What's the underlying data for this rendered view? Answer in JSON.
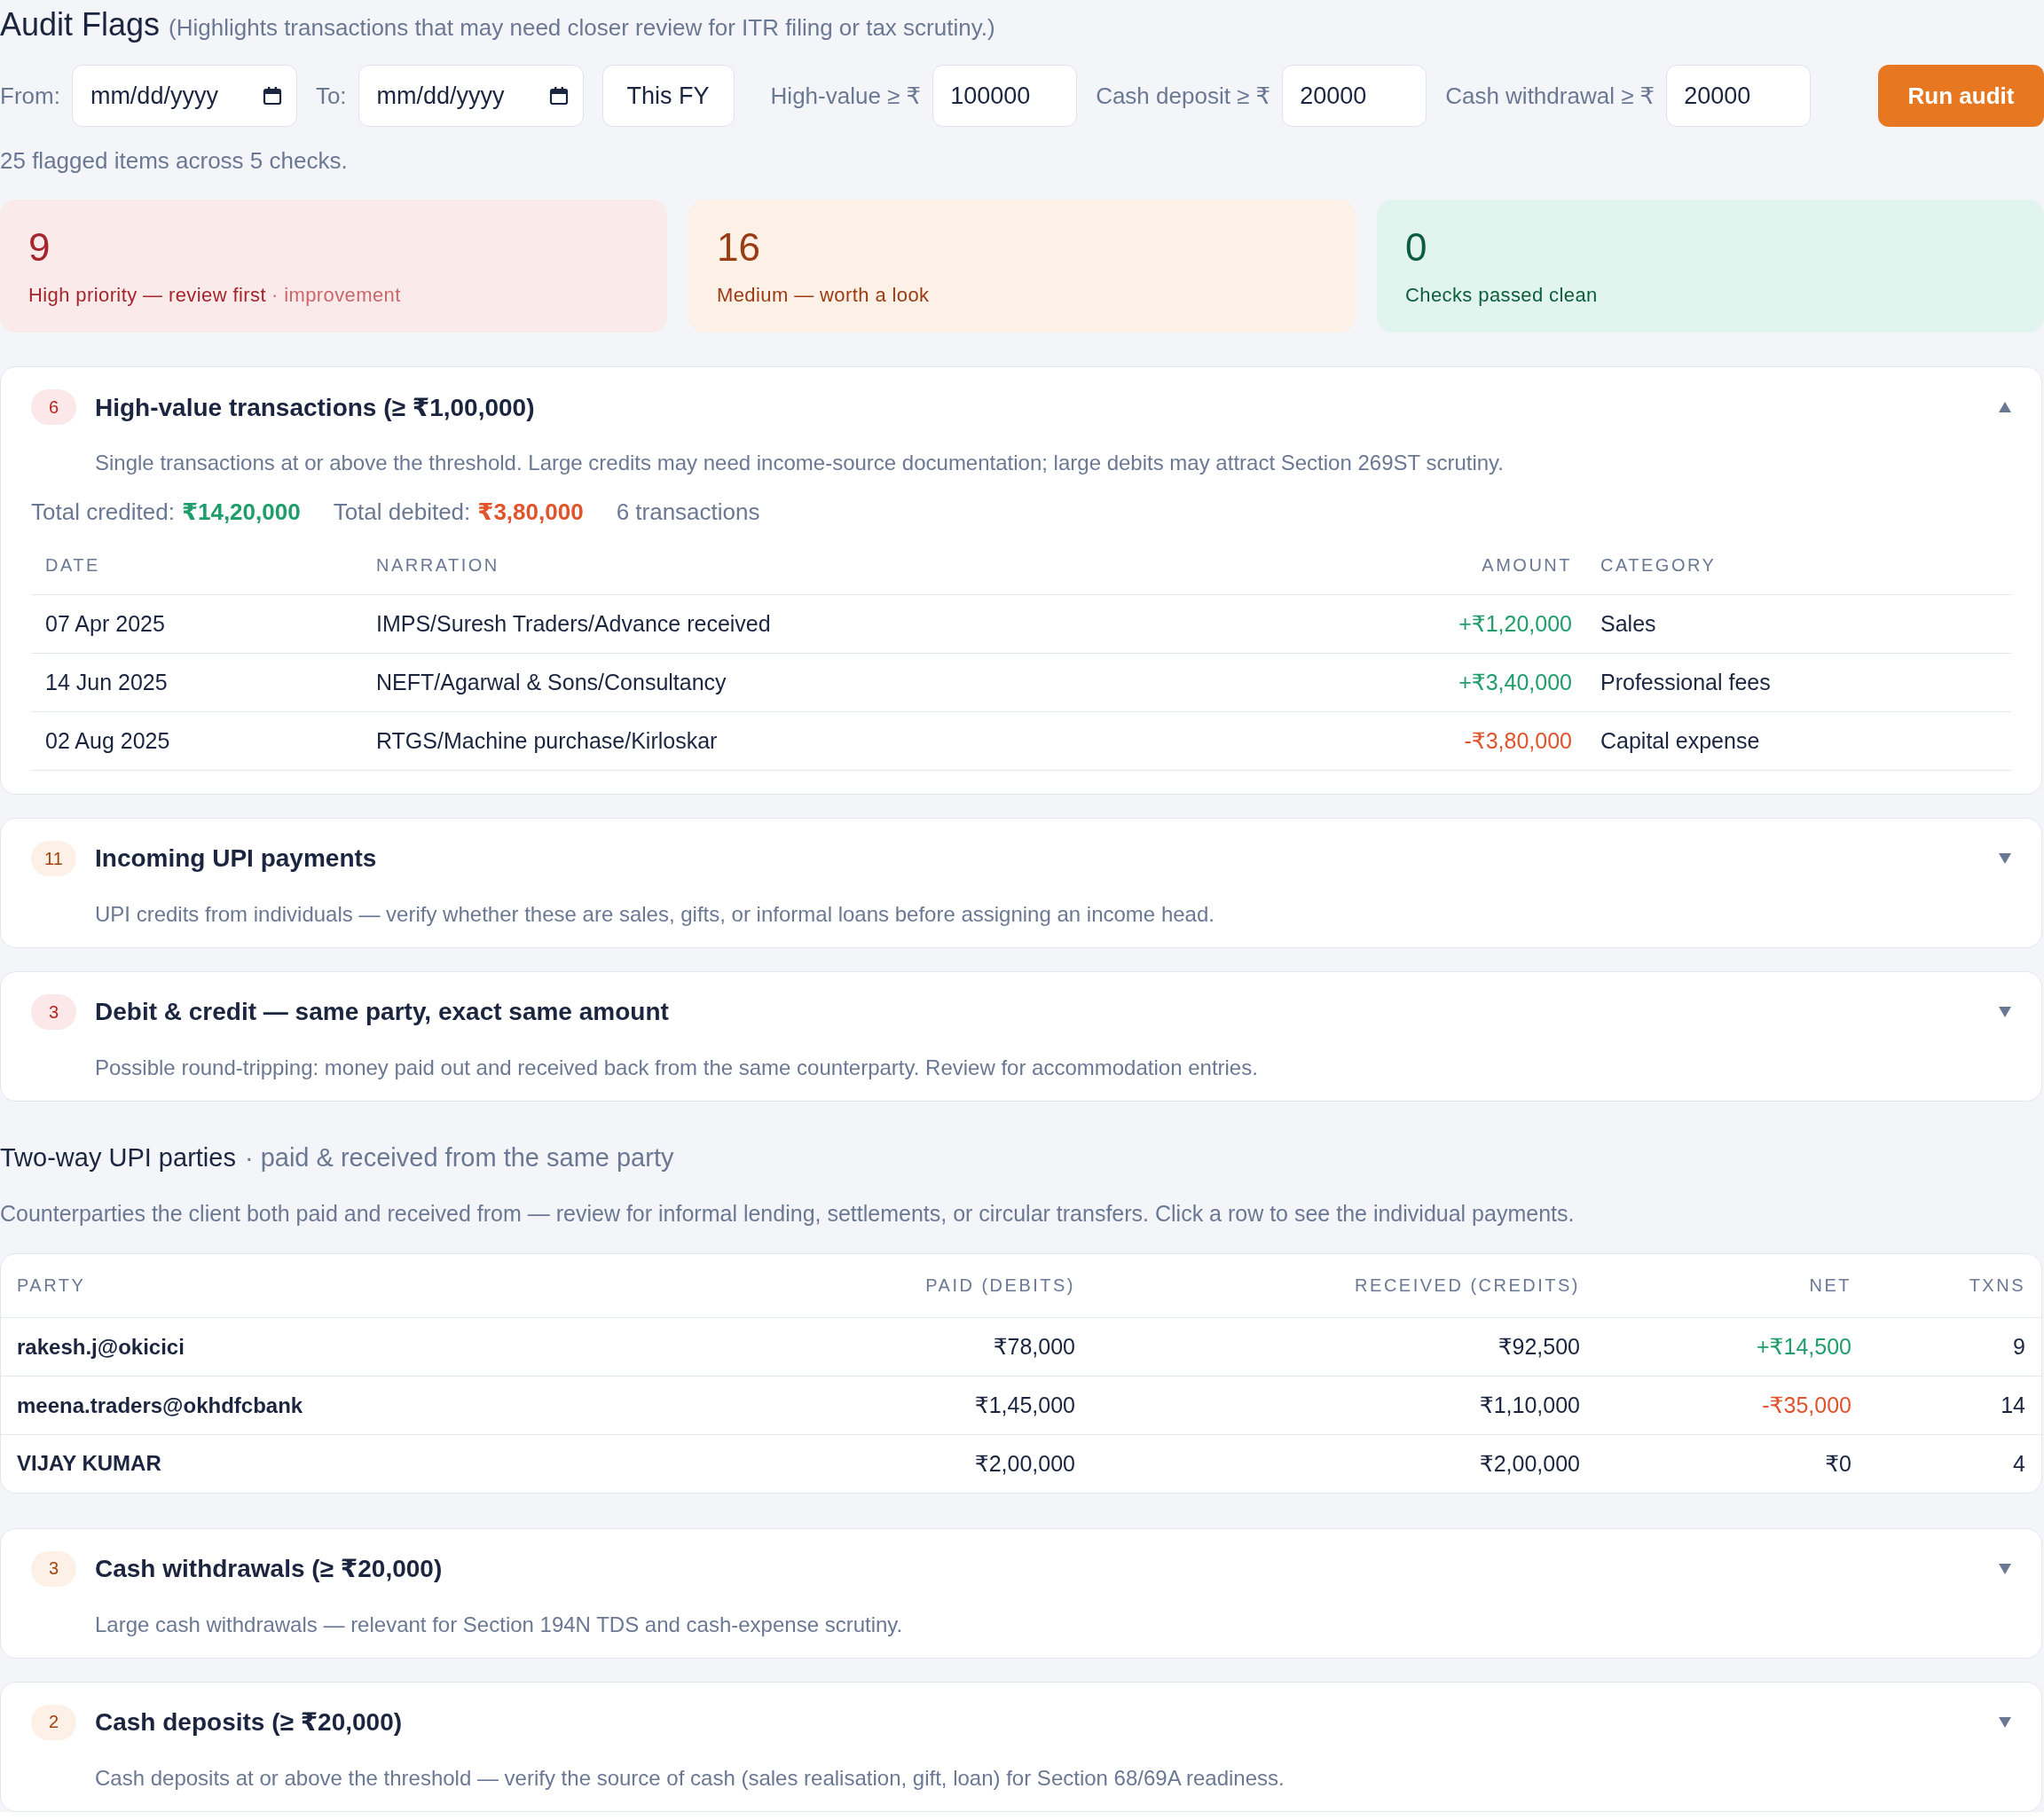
{
  "header": {
    "title": "Audit Flags",
    "subtitle": "(Highlights transactions that may need closer review for ITR filing or tax scrutiny.)"
  },
  "filters": {
    "from": {
      "label": "From:",
      "placeholder": "mm/dd/yyyy"
    },
    "to": {
      "label": "To:",
      "placeholder": "mm/dd/yyyy"
    },
    "preset_button": "This FY",
    "thresholds": [
      {
        "label": "High-value ≥ ₹",
        "value": "100000"
      },
      {
        "label": "Cash deposit ≥ ₹",
        "value": "20000"
      },
      {
        "label": "Cash withdrawal ≥ ₹",
        "value": "20000"
      }
    ],
    "run_button": "Run audit"
  },
  "summary_text": "25 flagged items across 5 checks.",
  "summary_cards": [
    {
      "kind": "high",
      "count": "9",
      "label": "High priority — review first",
      "note": "· improvement"
    },
    {
      "kind": "medium",
      "count": "16",
      "label": "Medium — worth a look"
    },
    {
      "kind": "clean",
      "count": "0",
      "label": "Checks passed clean"
    }
  ],
  "sections": [
    {
      "kind": "check",
      "badge": {
        "kind": "high",
        "count": "6"
      },
      "title": "High-value transactions (≥ ₹1,00,000)",
      "expanded": true,
      "description": "Single transactions at or above the threshold. Large credits may need income-source documentation; large debits may attract Section 269ST scrutiny.",
      "totals": [
        {
          "label": "Total credited:",
          "value": "₹14,20,000",
          "kind": "credit"
        },
        {
          "label": "Total debited:",
          "value": "₹3,80,000",
          "kind": "debit"
        }
      ],
      "transaction_count": "6 transactions",
      "table": {
        "columns": [
          "DATE",
          "NARRATION",
          "AMOUNT",
          "CATEGORY"
        ],
        "rows": [
          {
            "kind": "credit",
            "date": "07 Apr 2025",
            "narration": "IMPS/Suresh Traders/Advance received",
            "amount": "+₹1,20,000",
            "category": "Sales"
          },
          {
            "kind": "credit",
            "date": "14 Jun 2025",
            "narration": "NEFT/Agarwal & Sons/Consultancy",
            "amount": "+₹3,40,000",
            "category": "Professional fees"
          },
          {
            "kind": "debit",
            "date": "02 Aug 2025",
            "narration": "RTGS/Machine purchase/Kirloskar",
            "amount": "-₹3,80,000",
            "category": "Capital expense"
          }
        ]
      }
    },
    {
      "kind": "check",
      "badge": {
        "kind": "medium",
        "count": "11"
      },
      "title": "Incoming UPI payments",
      "expanded": false,
      "description": "UPI credits from individuals — verify whether these are sales, gifts, or informal loans before assigning an income head."
    },
    {
      "kind": "check",
      "badge": {
        "kind": "high",
        "count": "3"
      },
      "title": "Debit & credit — same party, exact same amount",
      "expanded": false,
      "description": "Possible round-tripping: money paid out and received back from the same counterparty. Review for accommodation entries."
    },
    {
      "kind": "party_table",
      "title": "Two-way UPI parties",
      "subtitle": "· paid & received from the same party",
      "description": "Counterparties the client both paid and received from — review for informal lending, settlements, or circular transfers. Click a row to see the individual payments.",
      "table": {
        "columns": [
          "PARTY",
          "PAID (DEBITS)",
          "RECEIVED (CREDITS)",
          "NET",
          "TXNS"
        ],
        "rows": [
          {
            "kind": "positive",
            "party": "rakesh.j@okicici",
            "paid": "₹78,000",
            "received": "₹92,500",
            "net": "+₹14,500",
            "txns": "9"
          },
          {
            "kind": "negative",
            "party": "meena.traders@okhdfcbank",
            "paid": "₹1,45,000",
            "received": "₹1,10,000",
            "net": "-₹35,000",
            "txns": "14"
          },
          {
            "kind": "zero",
            "party": "VIJAY KUMAR",
            "paid": "₹2,00,000",
            "received": "₹2,00,000",
            "net": "₹0",
            "txns": "4"
          }
        ]
      }
    },
    {
      "kind": "check",
      "badge": {
        "kind": "medium",
        "count": "3"
      },
      "title": "Cash withdrawals (≥ ₹20,000)",
      "expanded": false,
      "description": "Large cash withdrawals — relevant for Section 194N TDS and cash-expense scrutiny."
    },
    {
      "kind": "check",
      "badge": {
        "kind": "medium",
        "count": "2"
      },
      "title": "Cash deposits (≥ ₹20,000)",
      "expanded": false,
      "description": "Cash deposits at or above the threshold — verify the source of cash (sales realisation, gift, loan) for Section 68/69A readiness."
    }
  ]
}
